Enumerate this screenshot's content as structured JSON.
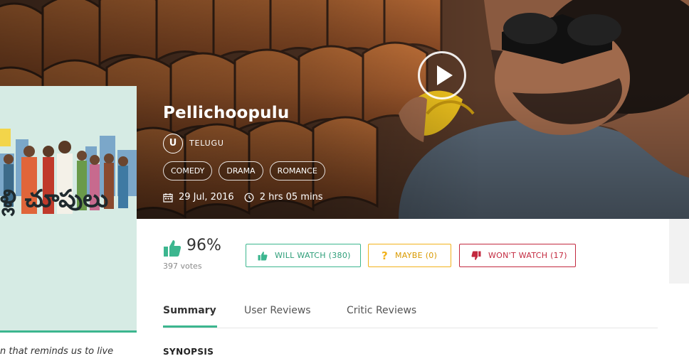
{
  "movie": {
    "title": "Pellichoopulu",
    "certificate": "U",
    "language": "TELUGU",
    "genres": [
      "COMEDY",
      "DRAMA",
      "ROMANCE"
    ],
    "release_date": "29 Jul, 2016",
    "duration": "2 hrs 05 mins"
  },
  "poster": {
    "caption": "n that reminds us to live",
    "title_art": "ళ్లి చూపులు"
  },
  "rating": {
    "percent": "96%",
    "votes": "397 votes"
  },
  "vote_buttons": {
    "will_watch": "WILL WATCH (380)",
    "maybe": "MAYBE (0)",
    "wont_watch": "WON'T WATCH (17)"
  },
  "tabs": [
    "Summary",
    "User Reviews",
    "Critic Reviews"
  ],
  "active_tab": "Summary",
  "section_heading": "SYNOPSIS",
  "colors": {
    "accent_green": "#3cb68f",
    "maybe_yellow": "#f2b21b",
    "wont_red": "#c3293f"
  },
  "icons": [
    "play-icon",
    "calendar-icon",
    "clock-icon",
    "thumbs-up-icon",
    "question-icon",
    "thumbs-down-icon"
  ]
}
